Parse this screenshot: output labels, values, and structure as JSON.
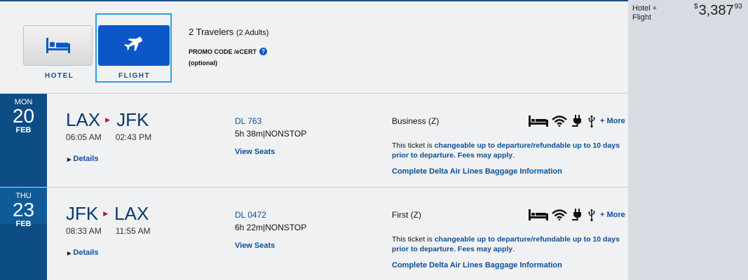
{
  "package": {
    "label": "Hotel + Flight",
    "price_currency": "$",
    "price_whole": "3,387",
    "price_cents": "93"
  },
  "tabs": {
    "hotel": "HOTEL",
    "flight": "FLIGHT"
  },
  "travelers": {
    "count": "2 Travelers",
    "detail": "(2 Adults)"
  },
  "promo": {
    "label": "PROMO CODE /eCERT",
    "help": "?",
    "optional": "(optional)"
  },
  "legs": [
    {
      "dow": "MON",
      "day": "20",
      "month": "FEB",
      "origin": "LAX",
      "destination": "JFK",
      "depart_time": "06:05 AM",
      "arrive_time": "02:43 PM",
      "details_label": "Details",
      "flight_number": "DL 763",
      "duration": "5h 38m|NONSTOP",
      "seats_label": "View Seats",
      "cabin": "Business (Z)",
      "more_label": "+ More",
      "ticket_prefix": "This ticket is ",
      "ticket_link": "changeable up to departure/refundable up to 10 days prior to departure. Fees may apply",
      "ticket_suffix": ".",
      "baggage_label": "Complete Delta Air Lines Baggage Information"
    },
    {
      "dow": "THU",
      "day": "23",
      "month": "FEB",
      "origin": "JFK",
      "destination": "LAX",
      "depart_time": "08:33 AM",
      "arrive_time": "11:55 AM",
      "details_label": "Details",
      "flight_number": "DL 0472",
      "duration": "6h 22m|NONSTOP",
      "seats_label": "View Seats",
      "cabin": "First (Z)",
      "more_label": "+ More",
      "ticket_prefix": "This ticket is ",
      "ticket_link": "changeable up to departure/refundable up to 10 days prior to departure. Fees may apply",
      "ticket_suffix": ".",
      "baggage_label": "Complete Delta Air Lines Baggage Information"
    }
  ],
  "icons": {
    "hotel_tab": "bed-icon",
    "flight_tab": "airplane-icon",
    "amenities": [
      "flat-bed-icon",
      "wifi-icon",
      "power-outlet-icon",
      "usb-icon"
    ]
  },
  "colors": {
    "brand_blue": "#0d4d85",
    "link_blue": "#0b4f99",
    "flight_tab": "#0b57c8",
    "selected_outline": "#2ba3dd",
    "route_arrow": "#d0021b"
  }
}
